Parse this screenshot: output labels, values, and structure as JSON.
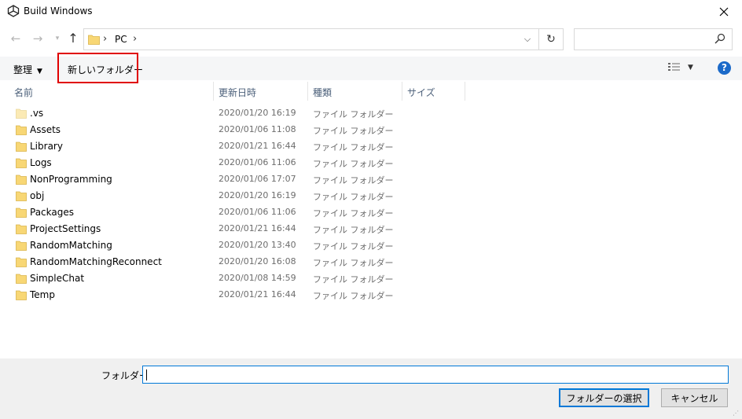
{
  "window": {
    "title": "Build Windows",
    "close_icon": "close-icon",
    "app_icon": "unity-icon"
  },
  "nav": {
    "back_icon": "arrow-left-icon",
    "forward_icon": "arrow-right-icon",
    "recent_icon": "chevron-down-icon",
    "up_icon": "arrow-up-icon"
  },
  "address": {
    "segments": [
      "PC"
    ],
    "separator": "›",
    "dropdown_icon": "chevron-down-icon",
    "refresh_icon": "refresh-icon"
  },
  "search": {
    "placeholder": "",
    "icon": "search-icon"
  },
  "toolbar": {
    "organize_label": "整理",
    "new_folder_label": "新しいフォルダー",
    "view_icon": "view-details-icon",
    "help_label": "?"
  },
  "columns": [
    "名前",
    "更新日時",
    "種類",
    "サイズ"
  ],
  "files": [
    {
      "name": ".vs",
      "date": "2020/01/20 16:19",
      "type": "ファイル フォルダー",
      "hidden": true
    },
    {
      "name": "Assets",
      "date": "2020/01/06 11:08",
      "type": "ファイル フォルダー",
      "hidden": false
    },
    {
      "name": "Library",
      "date": "2020/01/21 16:44",
      "type": "ファイル フォルダー",
      "hidden": false
    },
    {
      "name": "Logs",
      "date": "2020/01/06 11:06",
      "type": "ファイル フォルダー",
      "hidden": false
    },
    {
      "name": "NonProgramming",
      "date": "2020/01/06 17:07",
      "type": "ファイル フォルダー",
      "hidden": false
    },
    {
      "name": "obj",
      "date": "2020/01/20 16:19",
      "type": "ファイル フォルダー",
      "hidden": false
    },
    {
      "name": "Packages",
      "date": "2020/01/06 11:06",
      "type": "ファイル フォルダー",
      "hidden": false
    },
    {
      "name": "ProjectSettings",
      "date": "2020/01/21 16:44",
      "type": "ファイル フォルダー",
      "hidden": false
    },
    {
      "name": "RandomMatching",
      "date": "2020/01/20 13:40",
      "type": "ファイル フォルダー",
      "hidden": false
    },
    {
      "name": "RandomMatchingReconnect",
      "date": "2020/01/20 16:08",
      "type": "ファイル フォルダー",
      "hidden": false
    },
    {
      "name": "SimpleChat",
      "date": "2020/01/08 14:59",
      "type": "ファイル フォルダー",
      "hidden": false
    },
    {
      "name": "Temp",
      "date": "2020/01/21 16:44",
      "type": "ファイル フォルダー",
      "hidden": false
    }
  ],
  "footer": {
    "folder_label": "フォルダー:",
    "folder_value": "",
    "select_button": "フォルダーの選択",
    "cancel_button": "キャンセル"
  },
  "colors": {
    "accent": "#0078d7",
    "highlight_box": "#e00000",
    "folder": "#f8d775",
    "folder_hidden": "#fbeab5"
  }
}
